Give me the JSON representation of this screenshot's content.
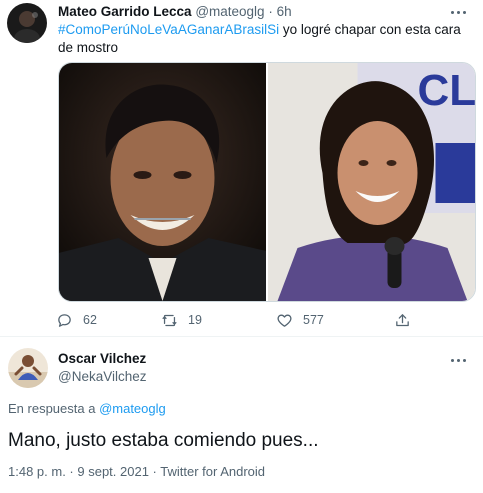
{
  "tweet1": {
    "author_name": "Mateo Garrido Lecca",
    "author_handle": "@mateoglg",
    "separator": "·",
    "age": "6h",
    "hashtag": "#ComoPerúNoLeVaAGanarABrasilSi",
    "text": " yo logré chapar con esta cara de mostro",
    "stats": {
      "replies": "62",
      "retweets": "19",
      "likes": "577"
    }
  },
  "tweet2": {
    "author_name": "Oscar Vilchez",
    "author_handle": "@NekaVilchez",
    "reply_prefix": "En respuesta a ",
    "reply_mention": "@mateoglg",
    "text": "Mano, justo estaba comiendo pues...",
    "time": "1:48 p. m.",
    "date": "9 sept. 2021",
    "source": "Twitter for Android",
    "meta_separator": " · "
  },
  "colors": {
    "link": "#1d9bf0",
    "secondary_text": "#536471",
    "primary_text": "#0f1419",
    "divider": "#eff3f4"
  },
  "icons": [
    "more-icon",
    "reply-icon",
    "retweet-icon",
    "like-icon",
    "share-icon"
  ]
}
